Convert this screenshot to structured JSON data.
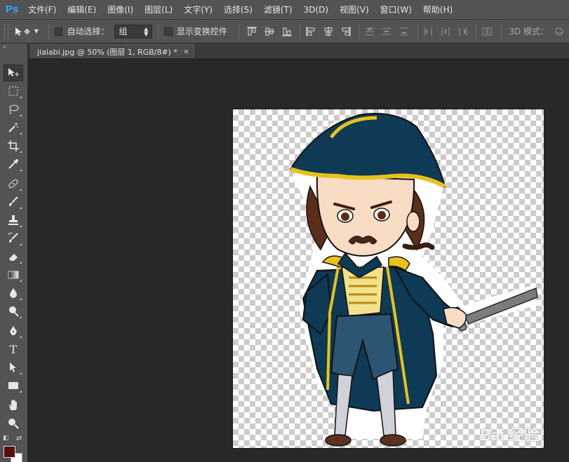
{
  "app": {
    "logo": "Ps"
  },
  "menu": [
    "文件(F)",
    "编辑(E)",
    "图像(I)",
    "图层(L)",
    "文字(Y)",
    "选择(S)",
    "滤镜(T)",
    "3D(D)",
    "视图(V)",
    "窗口(W)",
    "帮助(H)"
  ],
  "options": {
    "auto_select_label": "自动选择：",
    "auto_select_value": "组",
    "show_transform_label": "显示变换控件",
    "mode_3d_label": "3D 模式："
  },
  "document": {
    "tab_title": "jialabi.jpg @ 50% (图层 1, RGB/8#) *",
    "close_glyph": "×"
  },
  "colors": {
    "foreground": "#5c0d0d",
    "background": "#ffffff"
  },
  "tools": [
    "move-tool",
    "marquee-tool",
    "lasso-tool",
    "magic-wand-tool",
    "crop-tool",
    "eyedropper-tool",
    "healing-brush-tool",
    "brush-tool",
    "clone-stamp-tool",
    "history-brush-tool",
    "eraser-tool",
    "gradient-tool",
    "blur-tool",
    "dodge-tool",
    "pen-tool",
    "type-tool",
    "path-selection-tool",
    "rectangle-tool",
    "hand-tool",
    "zoom-tool"
  ],
  "type_tool_glyph": "T",
  "watermark": "Bai 经验"
}
